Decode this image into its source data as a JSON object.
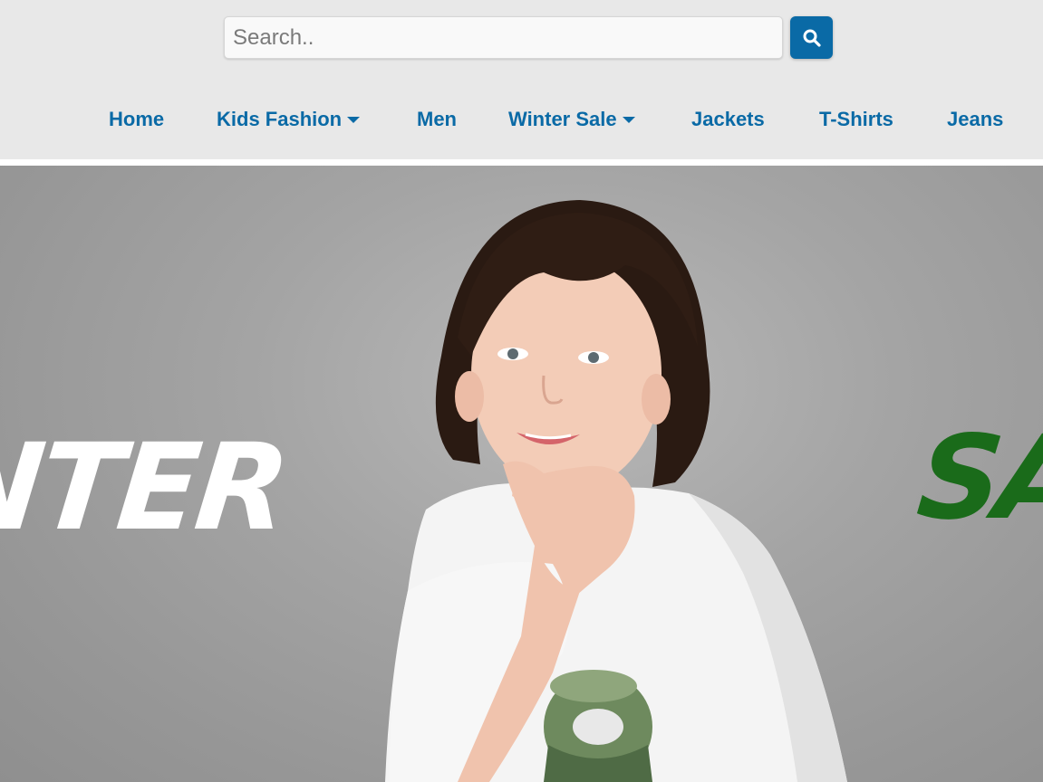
{
  "search": {
    "placeholder": "Search..",
    "value": "",
    "button_icon": "search-icon"
  },
  "nav": {
    "items": [
      {
        "label": "Home",
        "has_dropdown": false
      },
      {
        "label": "Kids Fashion",
        "has_dropdown": true
      },
      {
        "label": "Men",
        "has_dropdown": false
      },
      {
        "label": "Winter Sale",
        "has_dropdown": true
      },
      {
        "label": "Jackets",
        "has_dropdown": false
      },
      {
        "label": "T-Shirts",
        "has_dropdown": false
      },
      {
        "label": "Jeans",
        "has_dropdown": false
      }
    ]
  },
  "hero": {
    "left_text": "NTER",
    "right_text": "SA"
  },
  "colors": {
    "accent": "#0a6aa6",
    "header_bg": "#e8e8e8",
    "sale_green": "#1a6b1a"
  }
}
